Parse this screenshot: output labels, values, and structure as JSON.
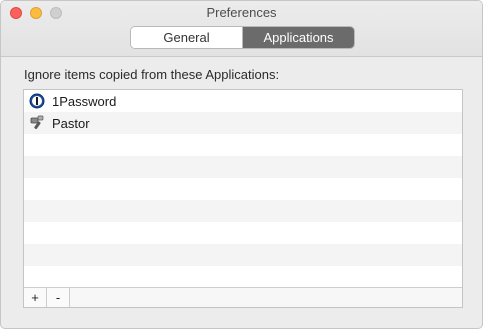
{
  "window": {
    "title": "Preferences"
  },
  "tabs": [
    {
      "label": "General",
      "selected": false
    },
    {
      "label": "Applications",
      "selected": true
    }
  ],
  "content": {
    "label": "Ignore items copied from these Applications:",
    "apps": [
      {
        "name": "1Password",
        "icon": "1password-icon"
      },
      {
        "name": "Pastor",
        "icon": "pastor-icon"
      }
    ]
  },
  "footer": {
    "add_label": "+",
    "remove_label": "-"
  },
  "colors": {
    "close": "#fc605c",
    "minimize": "#fdbc40",
    "zoom_disabled": "#cfcfcf",
    "active_tab": "#6b6b6b"
  }
}
